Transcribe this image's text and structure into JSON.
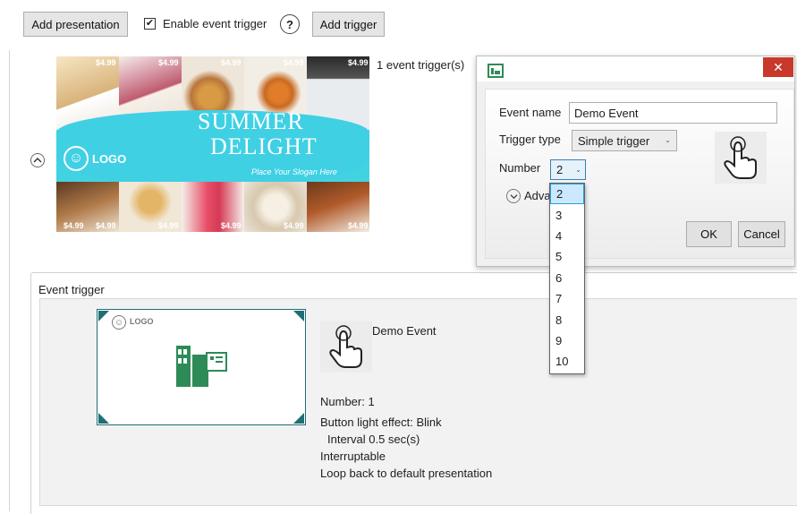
{
  "toolbar": {
    "add_presentation": "Add presentation",
    "enable_event_trigger": "Enable event trigger",
    "enable_event_trigger_checked": true,
    "help": "?",
    "add_trigger": "Add trigger"
  },
  "presentation": {
    "trigger_count": "1 event trigger(s)",
    "collapse_icon": "chevron-up-circle-icon",
    "banner": {
      "title_line1": "SUMMER",
      "title_line2": "DELIGHT",
      "logo_text": "LOGO",
      "slogan": "Place Your Slogan Here",
      "prices": [
        "$4.99",
        "$4.99",
        "$4.99",
        "$4.99",
        "$4.99",
        "$4.99",
        "$4.99",
        "$4.99",
        "$4.99",
        "$4.99",
        "$4.99"
      ]
    }
  },
  "dialog": {
    "title_icon": "app-icon",
    "close": "✕",
    "event_name_label": "Event name",
    "event_name_value": "Demo Event",
    "trigger_type_label": "Trigger type",
    "trigger_type_value": "Simple trigger",
    "number_label": "Number",
    "number_value": "2",
    "advanced_label": "Adva",
    "ok": "OK",
    "cancel": "Cancel",
    "number_options": [
      "2",
      "3",
      "4",
      "5",
      "6",
      "7",
      "8",
      "9",
      "10"
    ],
    "selected_option": "2"
  },
  "event_panel": {
    "group_title": "Event trigger",
    "preview_logo": "LOGO",
    "event_name": "Demo Event",
    "number_line": "Number: 1",
    "light_effect": "Button light effect: Blink",
    "interval": "Interval 0.5 sec(s)",
    "interruptable": "Interruptable",
    "loop_back": "Loop back to default presentation"
  },
  "colors": {
    "banner_cyan": "#42d3e3",
    "close_red": "#c8392b",
    "accent_teal": "#1f6e74",
    "logo_green": "#2e8b57",
    "selection_blue": "#cce8ff"
  }
}
